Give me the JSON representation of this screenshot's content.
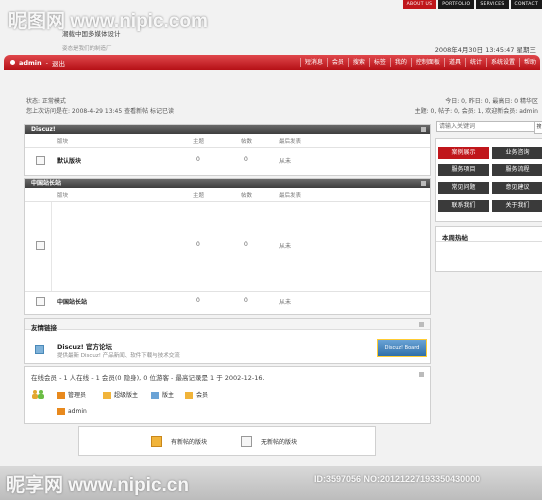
{
  "watermark": {
    "top": "昵图网 www.nipic.com",
    "bottom": "昵享网 www.nipic.cn",
    "id": "ID:3597056 NO:20121227193350430000"
  },
  "topnav": [
    "ABOUT US",
    "PORTFOLIO",
    "SERVICES",
    "CONTACT"
  ],
  "header": {
    "tagline": "潮载中国多媒体设计",
    "sub": "姿态是我们的制造厂",
    "datetime": "2008年4月30日 13:45:47 星期三"
  },
  "navbar": {
    "user": "admin",
    "logout": "退出",
    "menu": [
      "短消息",
      "会员",
      "搜索",
      "标签",
      "我的",
      "控制面板",
      "道具",
      "统计",
      "系统设置",
      "帮助"
    ]
  },
  "status": {
    "line1": "状态: 正常模式",
    "line2": "您上次访问是在: 2008-4-29 13:45 查看新帖  标记已读",
    "right1": "今日: 0, 昨日: 0, 最高日: 0  精华区",
    "right2": "主题: 0, 帖子: 0, 会员: 1, 欢迎新会员: admin"
  },
  "forums": {
    "discuz": {
      "title": "Discuz!",
      "cols": [
        "版块",
        "主题",
        "帖数",
        "最后发表"
      ],
      "rows": [
        {
          "name": "默认版块",
          "topics": "0",
          "posts": "0",
          "last": "从未"
        }
      ]
    },
    "china": {
      "title": "中国站长站",
      "cols": [
        "版块",
        "主题",
        "帖数",
        "最后发表"
      ],
      "rows": [
        {
          "name": "",
          "topics": "0",
          "posts": "0",
          "last": "从未"
        },
        {
          "name": "中国站长站",
          "topics": "0",
          "posts": "0",
          "last": "从未"
        }
      ]
    }
  },
  "links": {
    "title": "友情链接",
    "name": "Discuz! 官方论坛",
    "desc": "提供最新 Discuz! 产品新闻、软件下载与技术交流",
    "logo": "Discuz! Board"
  },
  "online": {
    "summary": "在线会员 - 1 人在线 - 1 会员(0 隐身), 0 位游客 - 最高记录是 1 于 2002-12-16.",
    "legend": [
      "管理员",
      "超级版主",
      "版主",
      "会员"
    ],
    "user": "admin"
  },
  "legend": {
    "new": "有新帖的版块",
    "nonew": "无新帖的版块"
  },
  "sidebar": {
    "search_placeholder": "请输入关键词",
    "search_btn": "搜",
    "buttons": [
      "案例展示",
      "业务咨询",
      "服务项目",
      "服务流程",
      "常见问题",
      "意见建议",
      "联系我们",
      "关于我们"
    ],
    "hot_title": "本周热帖"
  },
  "colors": {
    "accent": "#c0161b",
    "dark": "#3a3a3a",
    "header_gradient": "#555555"
  }
}
